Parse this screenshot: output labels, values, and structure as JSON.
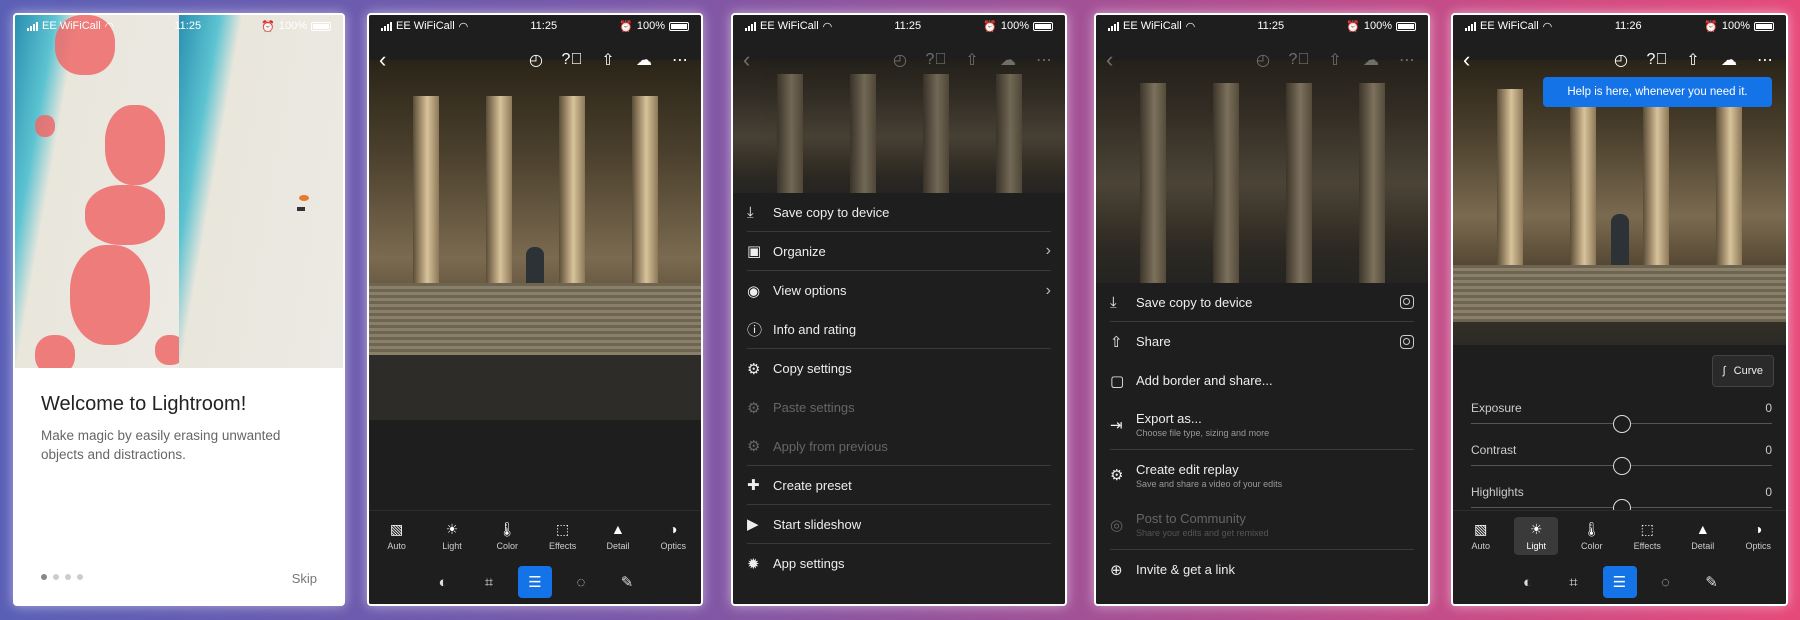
{
  "status": {
    "carrier": "EE WiFiCall",
    "battery": "100%",
    "time_1": "11:25",
    "time_2": "11:25",
    "time_3": "11:25",
    "time_4": "11:25",
    "time_5": "11:26"
  },
  "welcome": {
    "title": "Welcome to Lightroom!",
    "body": "Make magic by easily erasing unwanted objects and distractions.",
    "skip": "Skip",
    "page_index": 1,
    "page_count": 4
  },
  "tools": [
    {
      "label": "Auto",
      "glyph": "▧",
      "icon": "auto-icon"
    },
    {
      "label": "Light",
      "glyph": "☀",
      "icon": "light-icon"
    },
    {
      "label": "Color",
      "glyph": "🌡",
      "icon": "color-icon"
    },
    {
      "label": "Effects",
      "glyph": "⬚",
      "icon": "effects-icon"
    },
    {
      "label": "Detail",
      "glyph": "▲",
      "icon": "detail-icon"
    },
    {
      "label": "Optics",
      "glyph": "◑",
      "icon": "optics-icon"
    }
  ],
  "menu_more": {
    "items": [
      {
        "label": "Save copy to device",
        "icon": "⤓",
        "disabled": false,
        "chevron": false
      },
      {
        "label": "Organize",
        "icon": "▣",
        "disabled": false,
        "chevron": true
      },
      {
        "label": "View options",
        "icon": "◉",
        "disabled": false,
        "chevron": true
      },
      {
        "label": "Info and rating",
        "icon": "ⓘ",
        "disabled": false,
        "chevron": false
      },
      {
        "label": "Copy settings",
        "icon": "⚙",
        "disabled": false,
        "chevron": false
      },
      {
        "label": "Paste settings",
        "icon": "⚙",
        "disabled": true,
        "chevron": false
      },
      {
        "label": "Apply from previous",
        "icon": "⚙",
        "disabled": true,
        "chevron": false
      },
      {
        "label": "Create preset",
        "icon": "✚",
        "disabled": false,
        "chevron": false
      },
      {
        "label": "Start slideshow",
        "icon": "▶",
        "disabled": false,
        "chevron": false
      },
      {
        "label": "App settings",
        "icon": "✹",
        "disabled": false,
        "chevron": false
      }
    ]
  },
  "menu_share": {
    "items": [
      {
        "label": "Save copy to device",
        "sub": "",
        "icon": "⤓",
        "disabled": false,
        "toggle": true
      },
      {
        "label": "Share",
        "sub": "",
        "icon": "⇧",
        "disabled": false,
        "toggle": true
      },
      {
        "label": "Add border and share...",
        "sub": "",
        "icon": "▢",
        "disabled": false,
        "toggle": false
      },
      {
        "label": "Export as...",
        "sub": "Choose file type, sizing and more",
        "icon": "⇥",
        "disabled": false,
        "toggle": false
      },
      {
        "label": "Create edit replay",
        "sub": "Save and share a video of your edits",
        "icon": "⚙",
        "disabled": false,
        "toggle": false
      },
      {
        "label": "Post to Community",
        "sub": "Share your edits and get remixed",
        "icon": "◎",
        "disabled": true,
        "toggle": false
      },
      {
        "label": "Invite & get a link",
        "sub": "",
        "icon": "⊕",
        "disabled": false,
        "toggle": false
      }
    ]
  },
  "light_panel": {
    "tooltip": "Help is here, whenever you need it.",
    "curve_label": "Curve",
    "sliders": [
      {
        "label": "Exposure",
        "value": "0",
        "position": 0.5
      },
      {
        "label": "Contrast",
        "value": "0",
        "position": 0.5
      },
      {
        "label": "Highlights",
        "value": "0",
        "position": 0.5
      }
    ]
  },
  "colors": {
    "accent": "#1473e6",
    "mask": "#ee6868",
    "panel_bg": "#1e1e1e"
  }
}
